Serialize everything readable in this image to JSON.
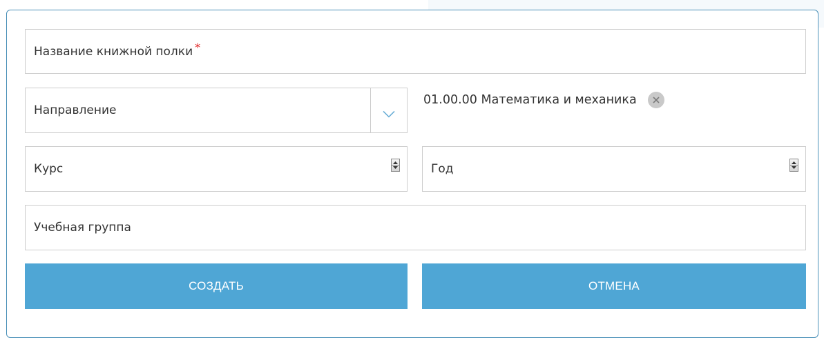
{
  "form": {
    "shelf_name": {
      "placeholder": "Название книжной полки",
      "required_mark": "*"
    },
    "direction": {
      "placeholder": "Направление",
      "icon": "chevron-down-icon"
    },
    "selected_direction": {
      "label": "01.00.00 Математика и механика",
      "remove_icon": "close-icon"
    },
    "course": {
      "placeholder": "Курс",
      "icon": "spinner-icon"
    },
    "year": {
      "placeholder": "Год",
      "icon": "spinner-icon"
    },
    "study_group": {
      "placeholder": "Учебная группа"
    }
  },
  "actions": {
    "create_label": "СОЗДАТЬ",
    "cancel_label": "ОТМЕНА"
  },
  "colors": {
    "button_bg": "#4fa6d5",
    "dialog_border": "#4a90b8",
    "required": "#e02020",
    "chevron": "#6aaed6"
  }
}
